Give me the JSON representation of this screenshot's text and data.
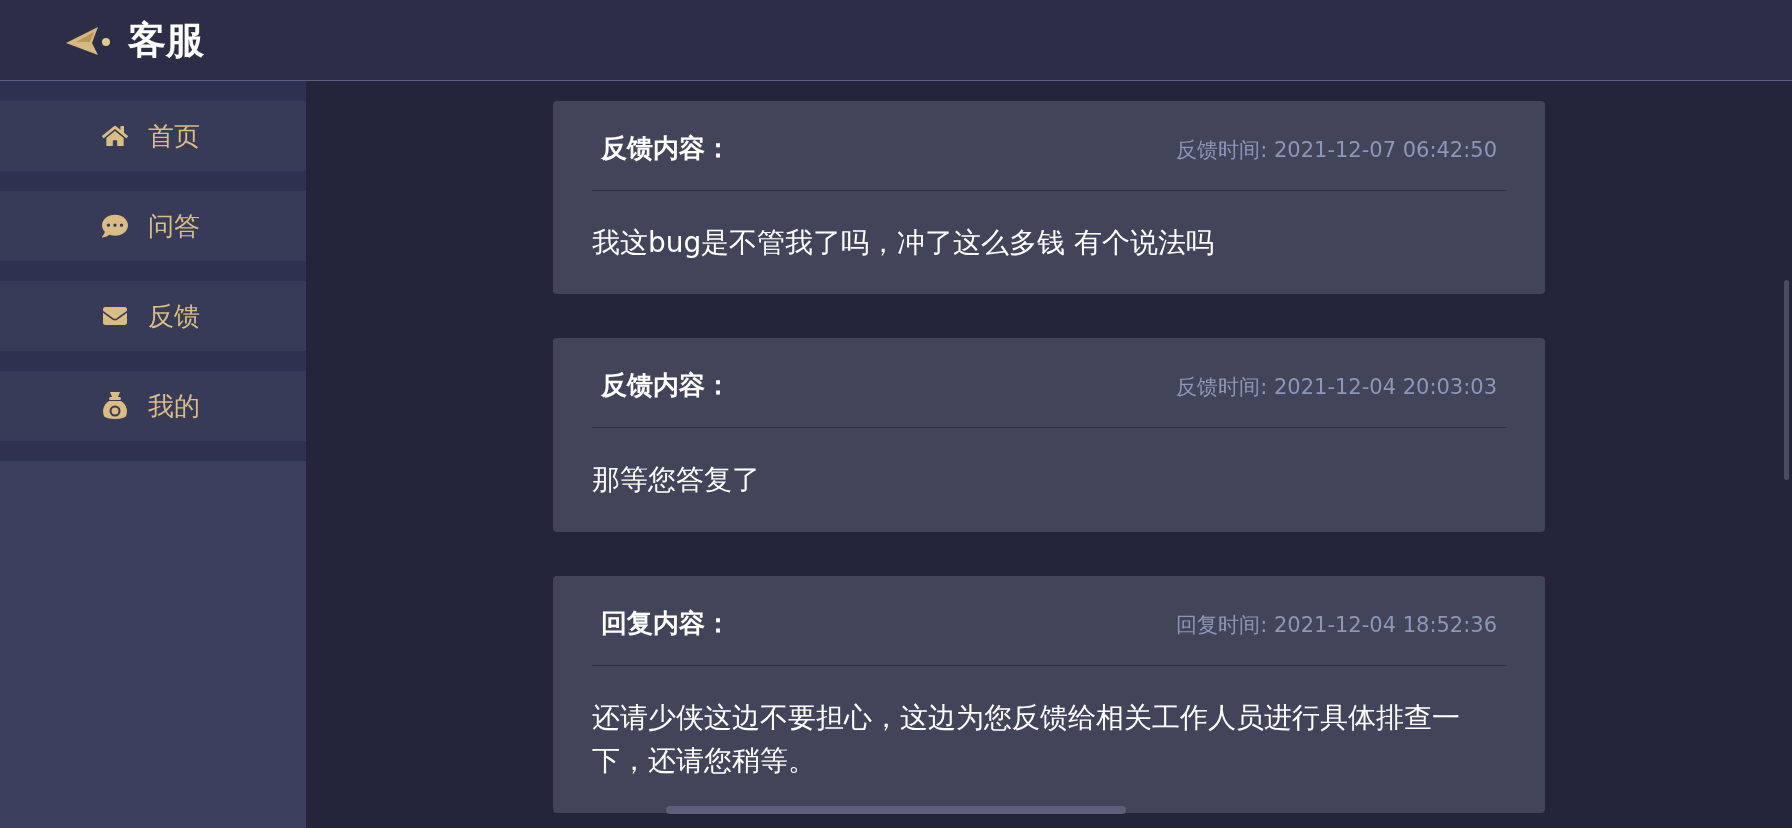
{
  "header": {
    "title": "客服"
  },
  "sidebar": {
    "items": [
      {
        "label": "首页"
      },
      {
        "label": "问答"
      },
      {
        "label": "反馈"
      },
      {
        "label": "我的"
      }
    ]
  },
  "messages": [
    {
      "heading": "反馈内容：",
      "time": "反馈时间: 2021-12-07 06:42:50",
      "body": "我这bug是不管我了吗，冲了这么多钱 有个说法吗"
    },
    {
      "heading": "反馈内容：",
      "time": "反馈时间: 2021-12-04 20:03:03",
      "body": "那等您答复了"
    },
    {
      "heading": "回复内容：",
      "time": "回复时间: 2021-12-04 18:52:36",
      "body": "还请少侠这边不要担心，这边为您反馈给相关工作人员进行具体排查一下，还请您稍等。"
    }
  ]
}
